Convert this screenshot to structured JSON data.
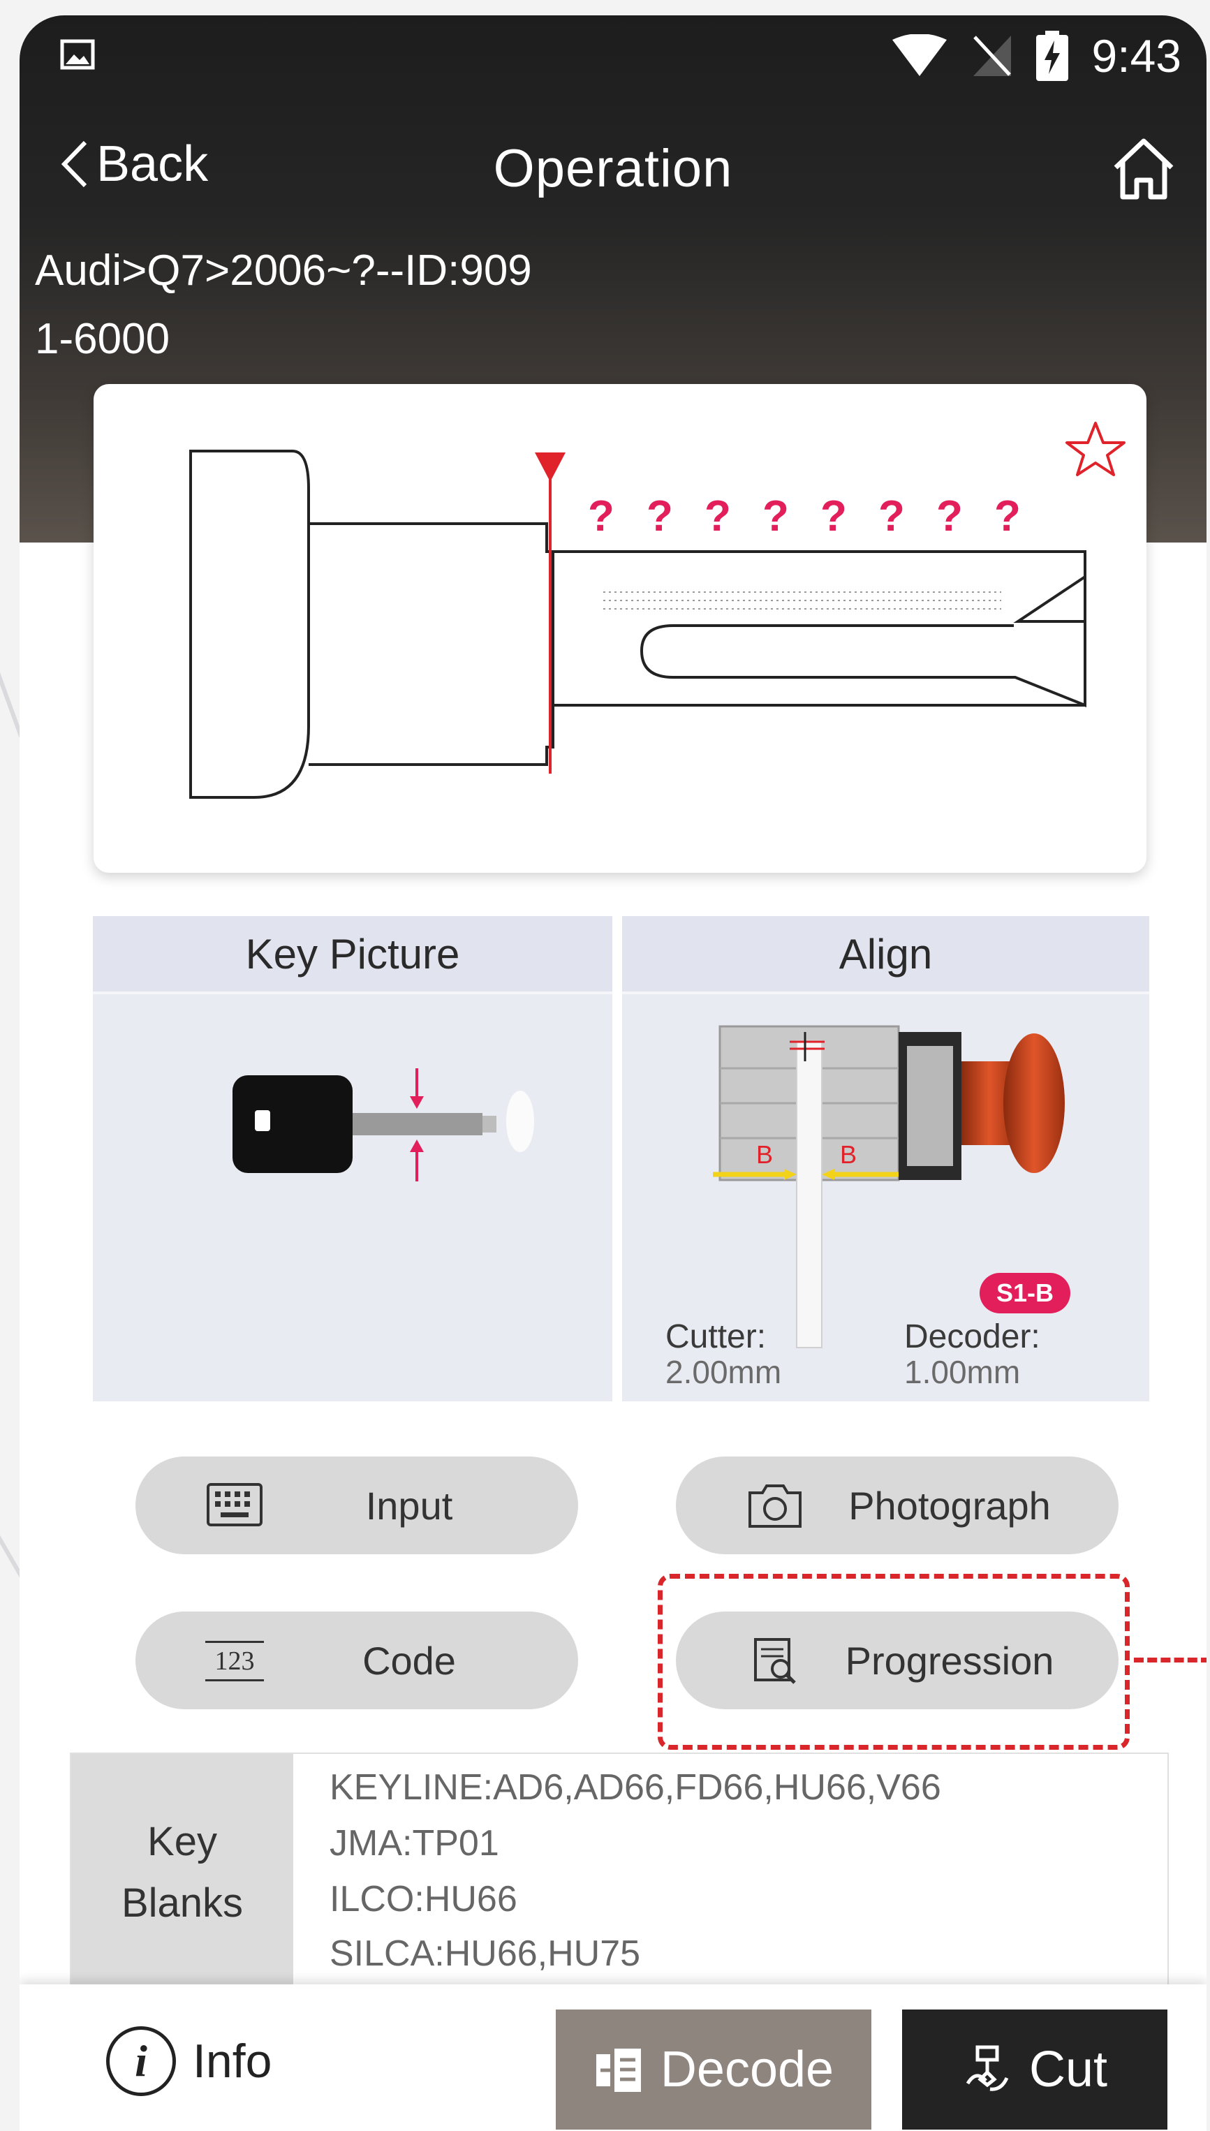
{
  "status_bar": {
    "time": "9:43"
  },
  "topbar": {
    "back_label": "Back",
    "title": "Operation"
  },
  "breadcrumb": {
    "path": "Audi>Q7>2006~?--ID:909",
    "range": "1-6000"
  },
  "key_diagram": {
    "cut_unknown": [
      "?",
      "?",
      "?",
      "?",
      "?",
      "?",
      "?",
      "?"
    ]
  },
  "panels": {
    "key_picture_label": "Key Picture",
    "align_label": "Align",
    "cutter_label": "Cutter:",
    "cutter_value": "2.00mm",
    "decoder_label": "Decoder:",
    "decoder_value": "1.00mm",
    "align_badge": "S1-B",
    "align_mark": "B"
  },
  "actions": {
    "input": "Input",
    "photograph": "Photograph",
    "code": "Code",
    "progression": "Progression",
    "code_icon_text": "123"
  },
  "key_blanks": {
    "header_line1": "Key",
    "header_line2": "Blanks",
    "lines": [
      "KEYLINE:AD6,AD66,FD66,HU66,V66",
      "JMA:TP01",
      "ILCO:HU66",
      "SILCA:HU66,HU75"
    ]
  },
  "footer": {
    "info": "Info",
    "decode": "Decode",
    "cut": "Cut"
  },
  "colors": {
    "accent_red": "#d9262b",
    "badge_pink": "#e21f5b",
    "decode_bg": "#8f857f",
    "cut_bg": "#232323"
  }
}
